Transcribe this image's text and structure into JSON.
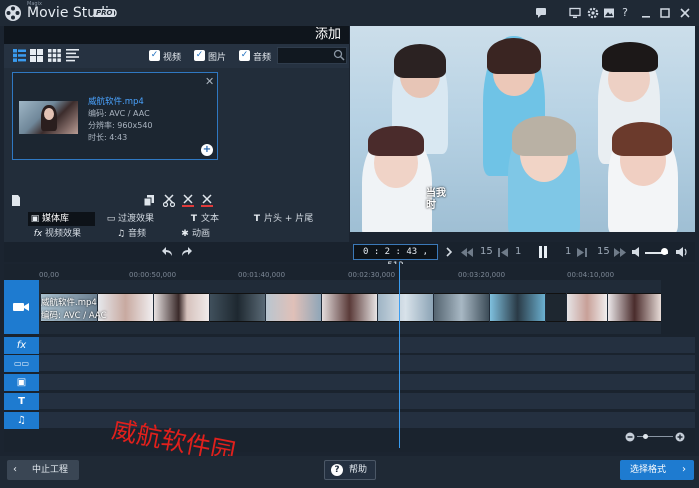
{
  "titlebar": {
    "brand_small": "Magix",
    "title": "Movie Studio",
    "badge": "PRO",
    "icons": [
      "chat-icon",
      "monitor-icon",
      "gear-icon",
      "image-icon",
      "help-icon",
      "minimize-icon",
      "maximize-icon",
      "close-icon"
    ],
    "help_glyph": "?"
  },
  "add_panel": {
    "title": "添加",
    "filters": [
      {
        "label": "视频",
        "checked": true
      },
      {
        "label": "图片",
        "checked": true
      },
      {
        "label": "音频",
        "checked": true
      }
    ],
    "search": {
      "placeholder": ""
    }
  },
  "media_item": {
    "name": "威航软件.mp4",
    "codec": "编码: AVC / AAC",
    "resolution": "分辨率: 960x540",
    "duration": "时长: 4:43",
    "close_glyph": "✕",
    "add_glyph": "+"
  },
  "tabs": [
    {
      "label": "媒体库",
      "icon": "media-icon"
    },
    {
      "label": "过渡效果",
      "icon": "transition-icon"
    },
    {
      "label": "文本",
      "icon": "text-icon"
    },
    {
      "label": "片头 + 片尾",
      "icon": "title-icon"
    },
    {
      "label": "视频效果",
      "icon": "fx-icon"
    },
    {
      "label": "音频",
      "icon": "music-icon"
    },
    {
      "label": "动画",
      "icon": "animation-icon"
    }
  ],
  "preview": {
    "subtitle": "当我",
    "subtitle2": "时"
  },
  "playback": {
    "timecode": "0 : 2 : 43 , 512",
    "step_back_15": "15",
    "step_back_1": "1",
    "step_fwd_1": "1",
    "step_fwd_15": "15",
    "volume": 0.8
  },
  "timeline": {
    "ruler_labels": [
      "00,00",
      "00:00:50,000",
      "00:01:40,000",
      "00:02:30,000",
      "00:03:20,000",
      "00:04:10,000"
    ],
    "clip_name": "威航软件.mp4",
    "clip_codec": "编码: AVC / AAC",
    "track_headers": [
      "fx-icon",
      "transition-icon",
      "image-icon",
      "text-icon",
      "music-icon"
    ],
    "track_glyphs": [
      "fx",
      "▭▭",
      "▣",
      "T",
      "♫"
    ]
  },
  "watermark": "威航软件园",
  "bottom": {
    "cancel_label": "中止工程",
    "help_label": "帮助",
    "format_label": "选择格式",
    "help_glyph": "?"
  },
  "colors": {
    "accent": "#1e7bd0",
    "playhead": "#3a9cf0",
    "watermark": "#e0201c",
    "link": "#4aa3ff"
  }
}
